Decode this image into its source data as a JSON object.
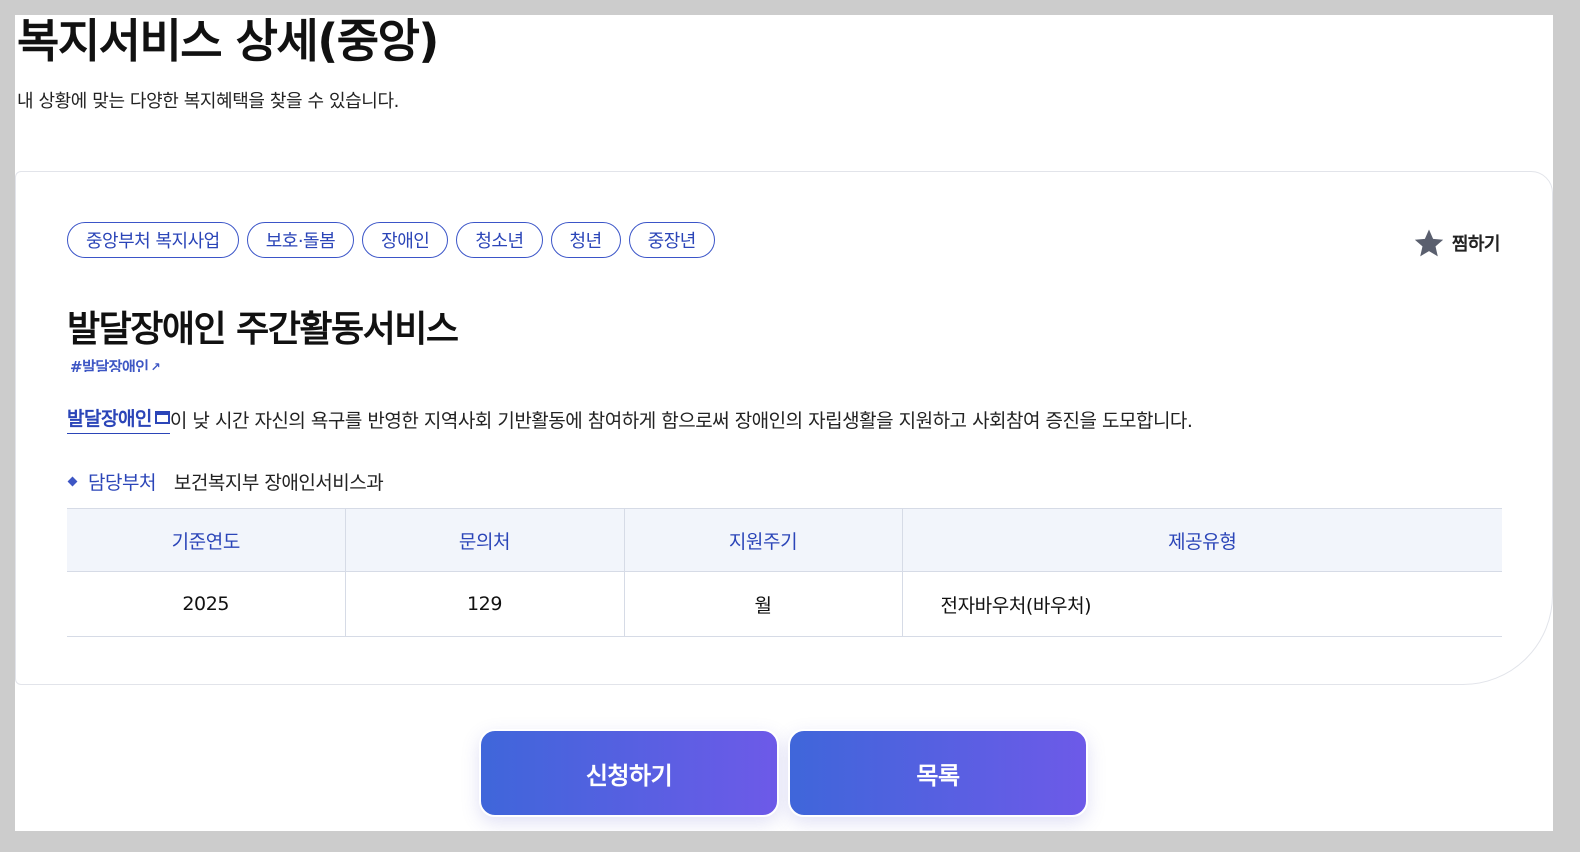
{
  "header": {
    "title": "복지서비스 상세(중앙)",
    "subtitle": "내 상황에 맞는 다양한 복지혜택을 찾을 수 있습니다."
  },
  "tags": [
    "중앙부처 복지사업",
    "보호·돌봄",
    "장애인",
    "청소년",
    "청년",
    "중장년"
  ],
  "bookmark": {
    "label": "찜하기",
    "icon": "star-icon"
  },
  "service": {
    "title": "발달장애인 주간활동서비스",
    "hashtag": "#발달장애인",
    "desc_link": "발달장애인",
    "desc_text": "이 낮 시간 자신의 욕구를 반영한 지역사회 기반활동에 참여하게 함으로써 장애인의 자립생활을 지원하고 사회참여 증진을 도모합니다."
  },
  "department": {
    "label": "담당부처",
    "value": "보건복지부 장애인서비스과"
  },
  "info_table": {
    "headers": [
      "기준연도",
      "문의처",
      "지원주기",
      "제공유형"
    ],
    "row": [
      "2025",
      "129",
      "월",
      "전자바우처(바우처)"
    ]
  },
  "buttons": {
    "apply": "신청하기",
    "list": "목록"
  },
  "colors": {
    "accent": "#2b45b8",
    "button_gradient_start": "#3f66da",
    "button_gradient_end": "#6d5ae8",
    "table_header_bg": "#f2f5fb"
  }
}
